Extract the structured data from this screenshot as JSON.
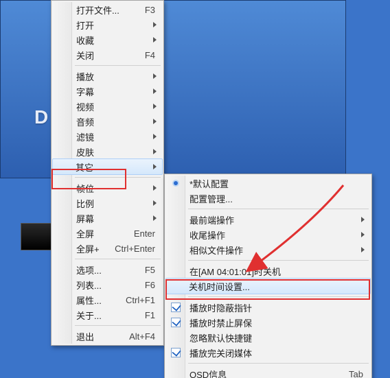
{
  "bg": {
    "letter": "D"
  },
  "menu1": {
    "groups": [
      [
        {
          "label": "打开文件...",
          "hotkey": "F3",
          "sub": false
        },
        {
          "label": "打开",
          "sub": true
        },
        {
          "label": "收藏",
          "sub": true
        },
        {
          "label": "关闭",
          "hotkey": "F4",
          "sub": false
        }
      ],
      [
        {
          "label": "播放",
          "sub": true
        },
        {
          "label": "字幕",
          "sub": true
        },
        {
          "label": "视频",
          "sub": true
        },
        {
          "label": "音频",
          "sub": true
        },
        {
          "label": "滤镜",
          "sub": true
        },
        {
          "label": "皮肤",
          "sub": true
        },
        {
          "label": "其它",
          "sub": true,
          "hovered": true
        }
      ],
      [
        {
          "label": "帧位",
          "sub": true
        },
        {
          "label": "比例",
          "sub": true
        },
        {
          "label": "屏幕",
          "sub": true
        },
        {
          "label": "全屏",
          "hotkey": "Enter",
          "sub": false
        },
        {
          "label": "全屏+",
          "hotkey": "Ctrl+Enter",
          "sub": false
        }
      ],
      [
        {
          "label": "选项...",
          "hotkey": "F5",
          "sub": false
        },
        {
          "label": "列表...",
          "hotkey": "F6",
          "sub": false
        },
        {
          "label": "属性...",
          "hotkey": "Ctrl+F1",
          "sub": false
        },
        {
          "label": "关于...",
          "hotkey": "F1",
          "sub": false
        }
      ],
      [
        {
          "label": "退出",
          "hotkey": "Alt+F4",
          "sub": false
        }
      ]
    ]
  },
  "menu2": {
    "groups": [
      [
        {
          "label": "*默认配置",
          "radio": true
        },
        {
          "label": "配置管理..."
        }
      ],
      [
        {
          "label": "最前端操作",
          "sub": true
        },
        {
          "label": "收尾操作",
          "sub": true
        },
        {
          "label": "相似文件操作",
          "sub": true
        }
      ],
      [
        {
          "label": "在[AM 04:01:01]时关机"
        },
        {
          "label": "关机时间设置...",
          "hovered": true
        }
      ],
      [
        {
          "label": "播放时隐蔽指针",
          "check": true,
          "checked": true
        },
        {
          "label": "播放时禁止屏保",
          "check": true,
          "checked": true
        },
        {
          "label": "忽略默认快捷键"
        },
        {
          "label": "播放完关闭媒体",
          "check": true,
          "checked": true
        }
      ],
      [
        {
          "label": "OSD信息",
          "hotkey": "Tab"
        }
      ]
    ]
  }
}
